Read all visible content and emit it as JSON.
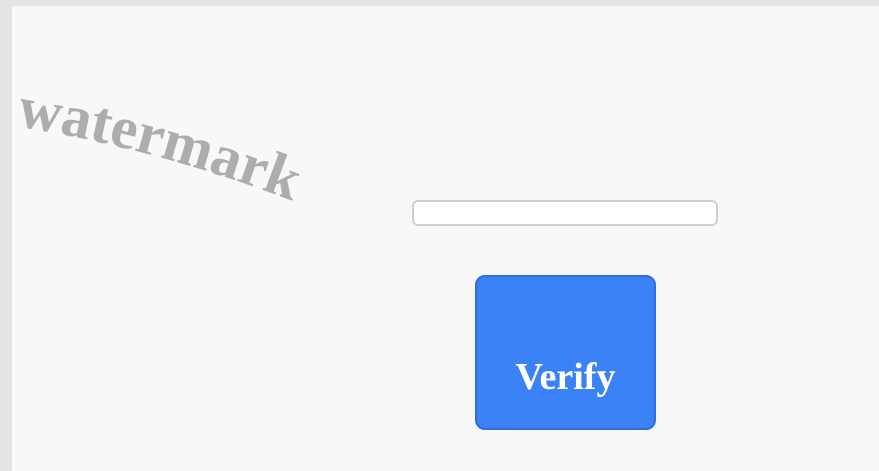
{
  "watermark": {
    "text": "watermark"
  },
  "form": {
    "code_input": {
      "value": "",
      "placeholder": ""
    },
    "verify_label": "Verify"
  },
  "colors": {
    "page_background": "#f8f8f8",
    "outer_background": "#e4e4e4",
    "button_background": "#3b82f6",
    "button_text": "#ffffff",
    "watermark_text": "#adadad",
    "input_border": "#cfcfcf"
  }
}
